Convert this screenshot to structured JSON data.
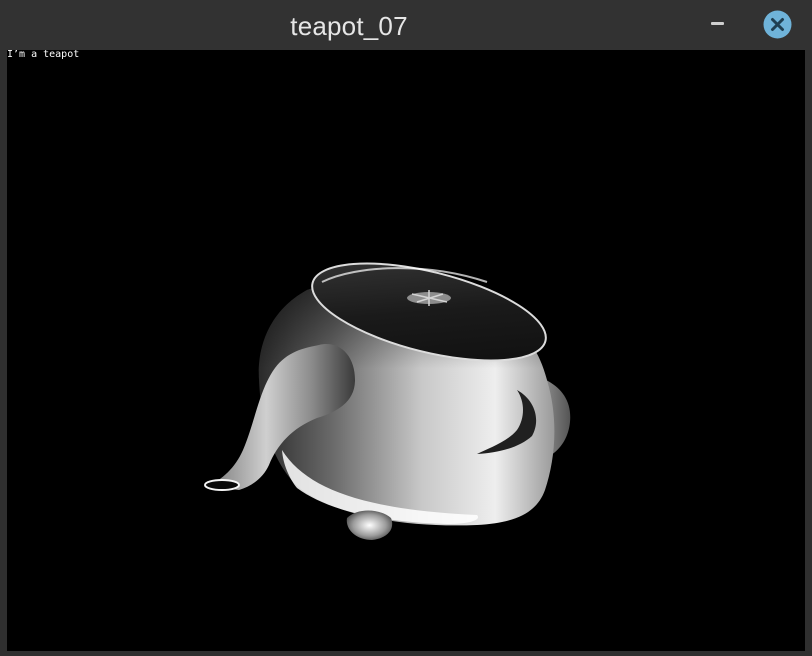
{
  "window": {
    "title": "teapot_07",
    "close_color": "#6fb3d9"
  },
  "viewport": {
    "overlay_text": "I’m a teapot",
    "background": "#000000"
  }
}
